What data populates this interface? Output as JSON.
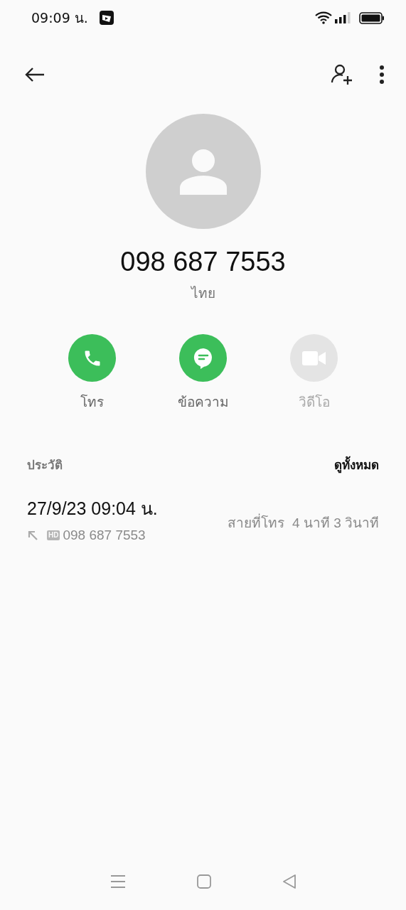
{
  "status_bar": {
    "time": "09:09 น."
  },
  "contact": {
    "number": "098 687 7553",
    "location": "ไทย"
  },
  "actions": [
    {
      "kind": "call",
      "label": "โทร",
      "disabled": false
    },
    {
      "kind": "message",
      "label": "ข้อความ",
      "disabled": false
    },
    {
      "kind": "video",
      "label": "วิดีโอ",
      "disabled": true
    }
  ],
  "history": {
    "title": "ประวัติ",
    "view_all": "ดูทั้งหมด",
    "entries": [
      {
        "datetime": "27/9/23 09:04 น.",
        "badge": "HD",
        "number": "098 687 7553",
        "type": "สายที่โทร",
        "duration": "4 นาที 3 วินาที"
      }
    ]
  }
}
